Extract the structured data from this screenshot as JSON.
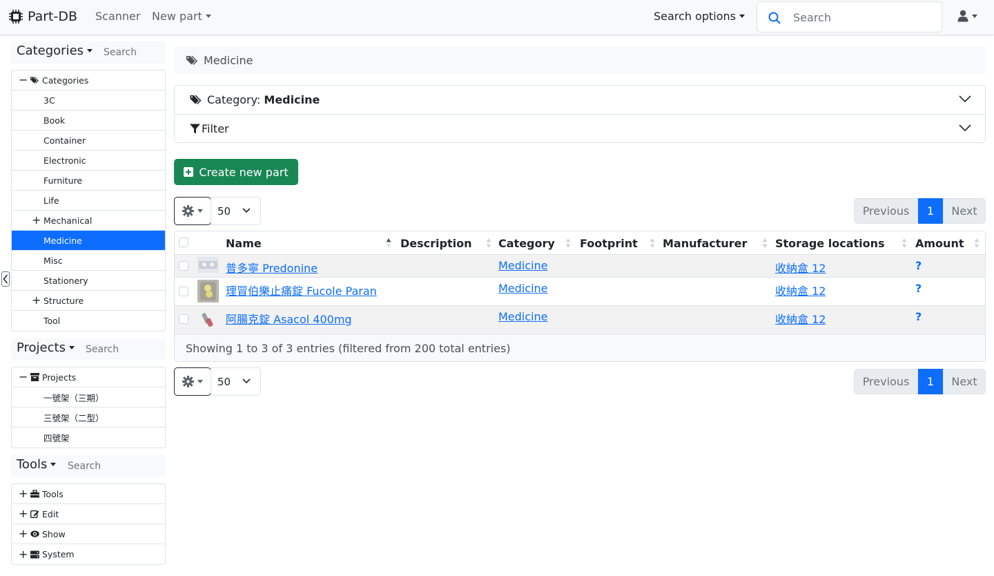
{
  "navbar": {
    "brand": "Part-DB",
    "scanner": "Scanner",
    "new_part": "New part",
    "search_options": "Search options",
    "search_placeholder": "Search"
  },
  "sidebar": {
    "categories": {
      "title": "Categories",
      "search_placeholder": "Search",
      "root": "Categories",
      "items": [
        {
          "label": "3C",
          "expandable": false
        },
        {
          "label": "Book",
          "expandable": false
        },
        {
          "label": "Container",
          "expandable": false
        },
        {
          "label": "Electronic",
          "expandable": false
        },
        {
          "label": "Furniture",
          "expandable": false
        },
        {
          "label": "Life",
          "expandable": false
        },
        {
          "label": "Mechanical",
          "expandable": true
        },
        {
          "label": "Medicine",
          "expandable": false,
          "active": true
        },
        {
          "label": "Misc",
          "expandable": false
        },
        {
          "label": "Stationery",
          "expandable": false
        },
        {
          "label": "Structure",
          "expandable": true
        },
        {
          "label": "Tool",
          "expandable": false
        }
      ]
    },
    "projects": {
      "title": "Projects",
      "search_placeholder": "Search",
      "root": "Projects",
      "items": [
        {
          "label": "一號架（三期）"
        },
        {
          "label": "三號架（二型）"
        },
        {
          "label": "四號架"
        }
      ]
    },
    "tools": {
      "title": "Tools",
      "search_placeholder": "Search",
      "items": [
        {
          "label": "Tools",
          "icon": "toolbox-icon"
        },
        {
          "label": "Edit",
          "icon": "edit-icon"
        },
        {
          "label": "Show",
          "icon": "eye-icon"
        },
        {
          "label": "System",
          "icon": "server-icon"
        }
      ]
    }
  },
  "breadcrumb": "Medicine",
  "accordion": {
    "category_prefix": "Category: ",
    "category_name": "Medicine",
    "filter": "Filter"
  },
  "create_button": "Create new part",
  "page_length": "50",
  "pagination": {
    "previous": "Previous",
    "page": "1",
    "next": "Next"
  },
  "table": {
    "columns": [
      "Name",
      "Description",
      "Category",
      "Footprint",
      "Manufacturer",
      "Storage locations",
      "Amount"
    ],
    "rows": [
      {
        "name": "普多寧 Predonine",
        "description": "",
        "category": "Medicine",
        "footprint": "",
        "manufacturer": "",
        "storage": "收納盒 12",
        "amount": "?"
      },
      {
        "name": "理冒伯樂止痛錠 Fucole Paran",
        "description": "",
        "category": "Medicine",
        "footprint": "",
        "manufacturer": "",
        "storage": "收納盒 12",
        "amount": "?"
      },
      {
        "name": "阿腸克錠 Asacol 400mg",
        "description": "",
        "category": "Medicine",
        "footprint": "",
        "manufacturer": "",
        "storage": "收納盒 12",
        "amount": "?"
      }
    ],
    "info": "Showing 1 to 3 of 3 entries (filtered from 200 total entries)"
  },
  "colors": {
    "primary": "#0d6efd",
    "success": "#198754"
  }
}
